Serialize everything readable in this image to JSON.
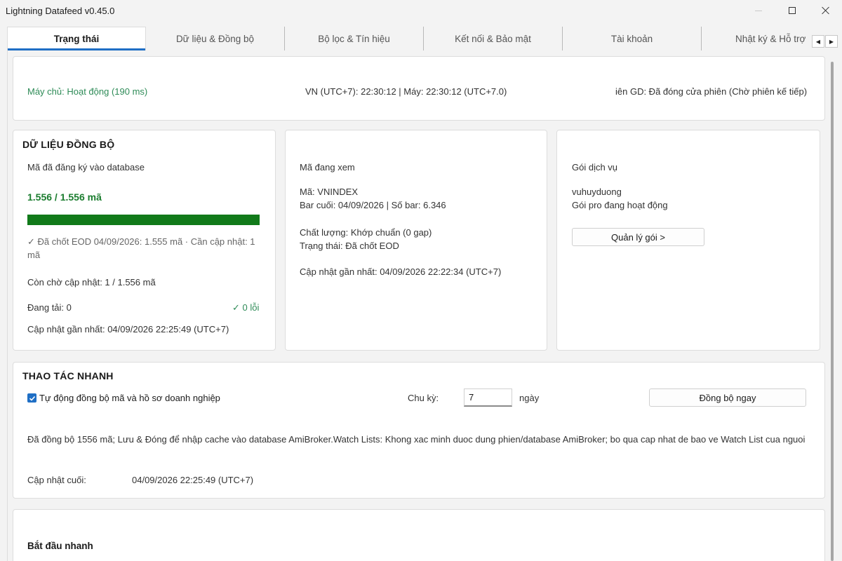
{
  "window": {
    "title": "Lightning Datafeed v0.45.0"
  },
  "tabs": [
    {
      "label": "Trạng thái"
    },
    {
      "label": "Dữ liệu & Đồng bộ"
    },
    {
      "label": "Bộ lọc & Tín hiệu"
    },
    {
      "label": "Kết nối & Bảo mật"
    },
    {
      "label": "Tài khoản"
    },
    {
      "label": "Nhật ký & Hỗ trợ"
    }
  ],
  "status_bar": {
    "server": "Máy chủ: Hoạt động (190 ms)",
    "time": "VN (UTC+7): 22:30:12 | Máy: 22:30:12 (UTC+7.0)",
    "session": "iên GD: Đã đóng cửa phiên (Chờ phiên kế tiếp)"
  },
  "sync_card": {
    "heading": "DỮ LIỆU ĐỒNG BỘ",
    "subtitle": "Mã đã đăng ký vào database",
    "count": "1.556 / 1.556 mã",
    "progress": 1.0,
    "eod_note": "✓ Đã chốt EOD 04/09/2026: 1.555 mã · Cần cập nhật: 1 mã",
    "pending": "Còn chờ cập nhật: 1 / 1.556 mã",
    "loading": "Đang tải: 0",
    "errors": "✓ 0 lỗi",
    "last_update": "Cập nhật gần nhất: 04/09/2026 22:25:49 (UTC+7)"
  },
  "viewing_card": {
    "title": "Mã đang xem",
    "symbol": "Mã: VNINDEX",
    "last_bar": "Bar cuối: 04/09/2026 | Số bar: 6.346",
    "quality": "Chất lượng: Khớp chuẩn (0 gap)",
    "state": "Trạng thái: Đã chốt EOD",
    "last_update": "Cập nhật gần nhất: 04/09/2026 22:22:34 (UTC+7)"
  },
  "plan_card": {
    "title": "Gói dịch vụ",
    "user": "vuhuyduong",
    "plan": "Gói pro đang hoạt động",
    "manage_button": "Quản lý gói >"
  },
  "quick_actions": {
    "heading": "THAO TÁC NHANH",
    "auto_sync_label": "Tự động đồng bộ mã và hồ sơ doanh nghiệp",
    "auto_sync_checked": true,
    "cycle_label": "Chu kỳ:",
    "cycle_value": "7",
    "cycle_unit": "ngày",
    "sync_now_button": "Đồng bộ ngay",
    "message": "Đã đồng bộ 1556 mã; Lưu & Đóng để nhập cache vào database AmiBroker.Watch Lists: Khong xac minh duoc dung phien/database AmiBroker; bo qua cap nhat de bao ve Watch List cua nguoi",
    "last_update_label": "Cập nhật cuối:",
    "last_update_value": "04/09/2026 22:25:49 (UTC+7)"
  },
  "quick_start": {
    "heading": "Bắt đầu nhanh"
  },
  "colors": {
    "accent": "#1f6fc5",
    "success": "#2e8b57",
    "progress": "#117a1a"
  }
}
